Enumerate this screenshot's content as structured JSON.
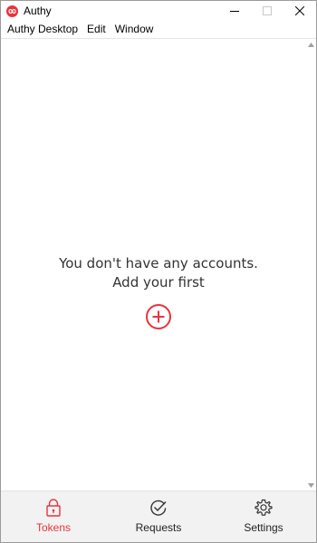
{
  "window": {
    "title": "Authy",
    "controls": [
      "minimize",
      "maximize",
      "close"
    ]
  },
  "menubar": {
    "items": [
      {
        "label": "Authy Desktop"
      },
      {
        "label": "Edit"
      },
      {
        "label": "Window"
      }
    ]
  },
  "main": {
    "empty_line1": "You don't have any accounts.",
    "empty_line2": "Add your first",
    "add_icon": "plus-circle-icon"
  },
  "bottom_nav": {
    "items": [
      {
        "label": "Tokens",
        "icon": "lock-icon",
        "active": true
      },
      {
        "label": "Requests",
        "icon": "check-circle-icon",
        "active": false
      },
      {
        "label": "Settings",
        "icon": "gear-icon",
        "active": false
      }
    ]
  },
  "colors": {
    "accent": "#e8343c",
    "nav_background": "#f2f2f2",
    "text": "#333333"
  }
}
